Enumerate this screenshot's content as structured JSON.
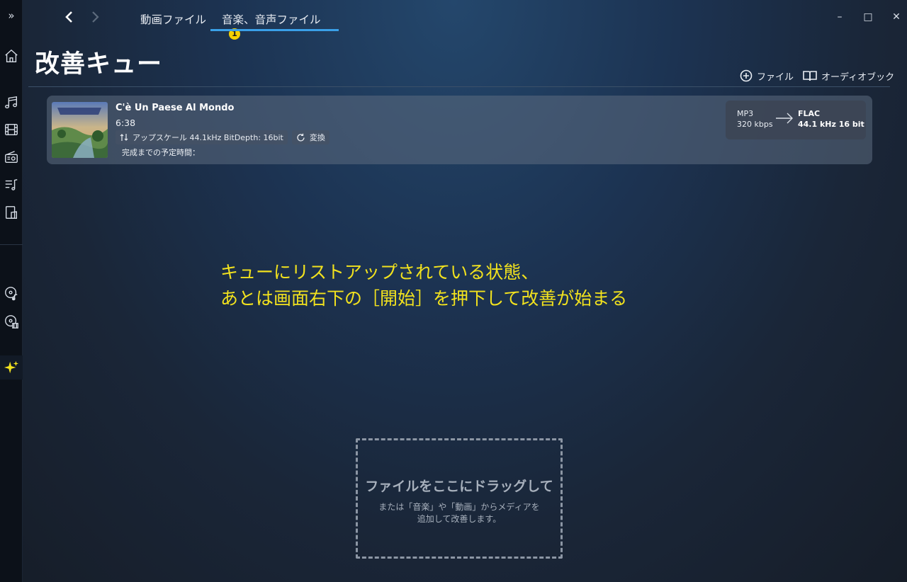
{
  "nav": {
    "expand_glyph": "»",
    "items": [
      {
        "name": "home-icon"
      },
      {
        "name": "music-icon"
      },
      {
        "name": "film-icon"
      },
      {
        "name": "radio-icon"
      },
      {
        "name": "playlist-icon"
      },
      {
        "name": "device-icon"
      },
      {
        "name": "disc-music-icon"
      },
      {
        "name": "disc-video-icon"
      },
      {
        "name": "sparkle-icon",
        "active": true
      }
    ]
  },
  "tabs": [
    {
      "label": "動画ファイル",
      "active": false
    },
    {
      "label": "音楽、音声ファイル",
      "active": true,
      "badge": "1"
    }
  ],
  "window_controls": {
    "minimize": "–",
    "maximize": "□",
    "close": "✕"
  },
  "page": {
    "title": "改善キュー",
    "actions": {
      "add_file": "ファイル",
      "audiobook": "オーディオブック"
    }
  },
  "queue": [
    {
      "title": "C'è Un Paese Al Mondo",
      "duration": "6:38",
      "upscale_chip": "アップスケール 44.1kHz BitDepth: 16bit",
      "convert_chip": "変換",
      "eta_label": "完成までの予定時間：",
      "source": {
        "format": "MP3",
        "bitrate": "320 kbps"
      },
      "target": {
        "format": "FLAC",
        "quality": "44.1 kHz 16 bit"
      }
    }
  ],
  "annotation": {
    "line1": "キューにリストアップされている状態、",
    "line2": "あとは画面右下の［開始］を押下して改善が始まる"
  },
  "dropzone": {
    "title": "ファイルをここにドラッグして",
    "subtitle": "または「音楽」や「動画」からメディアを追加して改善します。"
  },
  "colors": {
    "accent": "#3aa0e8",
    "badge": "#f5d000",
    "annotation": "#f2e21e"
  }
}
